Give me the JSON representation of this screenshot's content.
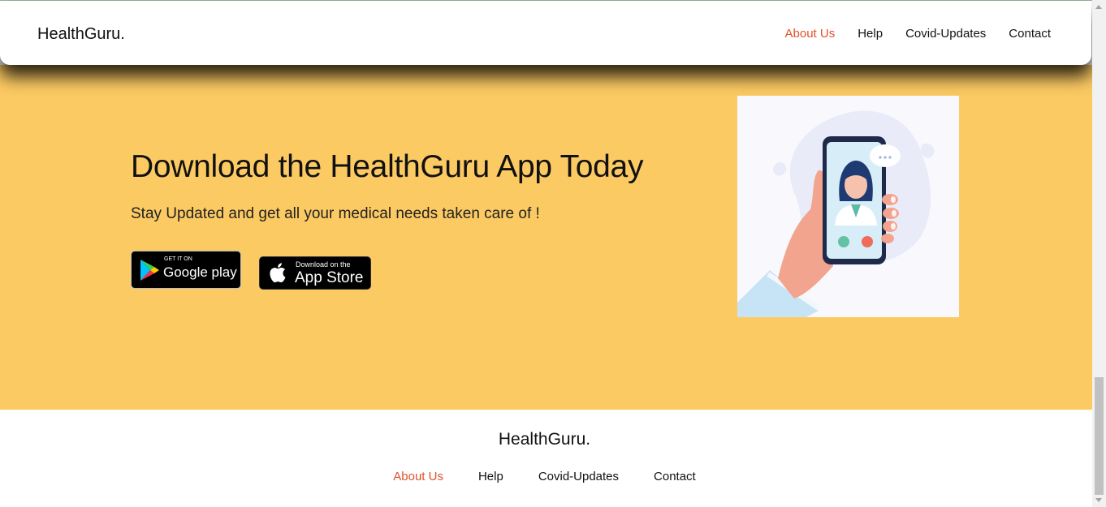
{
  "header": {
    "logo": "HealthGuru.",
    "nav": [
      {
        "label": "About Us"
      },
      {
        "label": "Help"
      },
      {
        "label": "Covid-Updates"
      },
      {
        "label": "Contact"
      }
    ]
  },
  "hero": {
    "title": "Download the HealthGuru App Today",
    "subtitle": "Stay Updated and get all your medical needs taken care of !",
    "google_badge": {
      "small": "GET IT ON",
      "big": "Google play",
      "icon": "google-play-icon"
    },
    "apple_badge": {
      "small": "Download on the",
      "big": "App Store",
      "icon": "apple-icon"
    },
    "illustration": "doctor-video-call-illustration"
  },
  "footer": {
    "logo": "HealthGuru.",
    "nav": [
      {
        "label": "About Us"
      },
      {
        "label": "Help"
      },
      {
        "label": "Covid-Updates"
      },
      {
        "label": "Contact"
      }
    ]
  },
  "colors": {
    "accent": "#e0512a",
    "hero_bg": "#fcca63",
    "text": "#111111"
  }
}
